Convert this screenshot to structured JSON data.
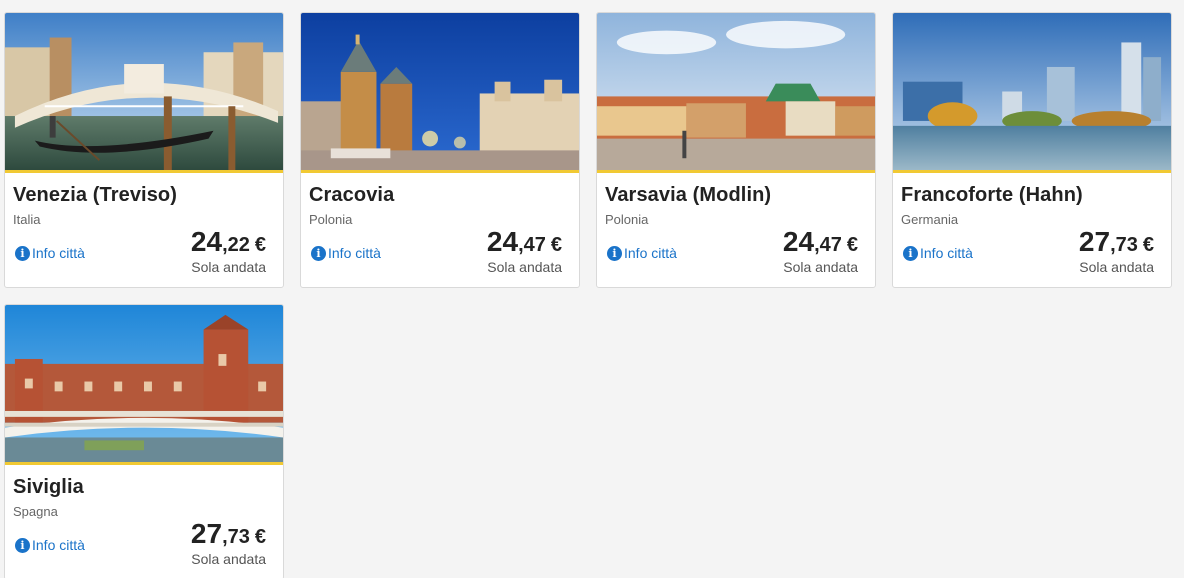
{
  "info_label": "Info città",
  "oneway_label": "Sola andata",
  "accent_border_color": "#f1c933",
  "link_color": "#1a73c9",
  "cards": [
    {
      "city": "Venezia (Treviso)",
      "country": "Italia",
      "price_int": "24",
      "price_dec": ",22",
      "currency": "€",
      "image": "venice-gondola-rialto-bridge"
    },
    {
      "city": "Cracovia",
      "country": "Polonia",
      "price_int": "24",
      "price_dec": ",47",
      "currency": "€",
      "image": "krakow-main-square-basilica"
    },
    {
      "city": "Varsavia (Modlin)",
      "country": "Polonia",
      "price_int": "24",
      "price_dec": ",47",
      "currency": "€",
      "image": "warsaw-old-town-square"
    },
    {
      "city": "Francoforte (Hahn)",
      "country": "Germania",
      "price_int": "27",
      "price_dec": ",73",
      "currency": "€",
      "image": "frankfurt-skyline-river"
    },
    {
      "city": "Siviglia",
      "country": "Spagna",
      "price_int": "27",
      "price_dec": ",73",
      "currency": "€",
      "image": "seville-plaza-de-espana"
    }
  ]
}
